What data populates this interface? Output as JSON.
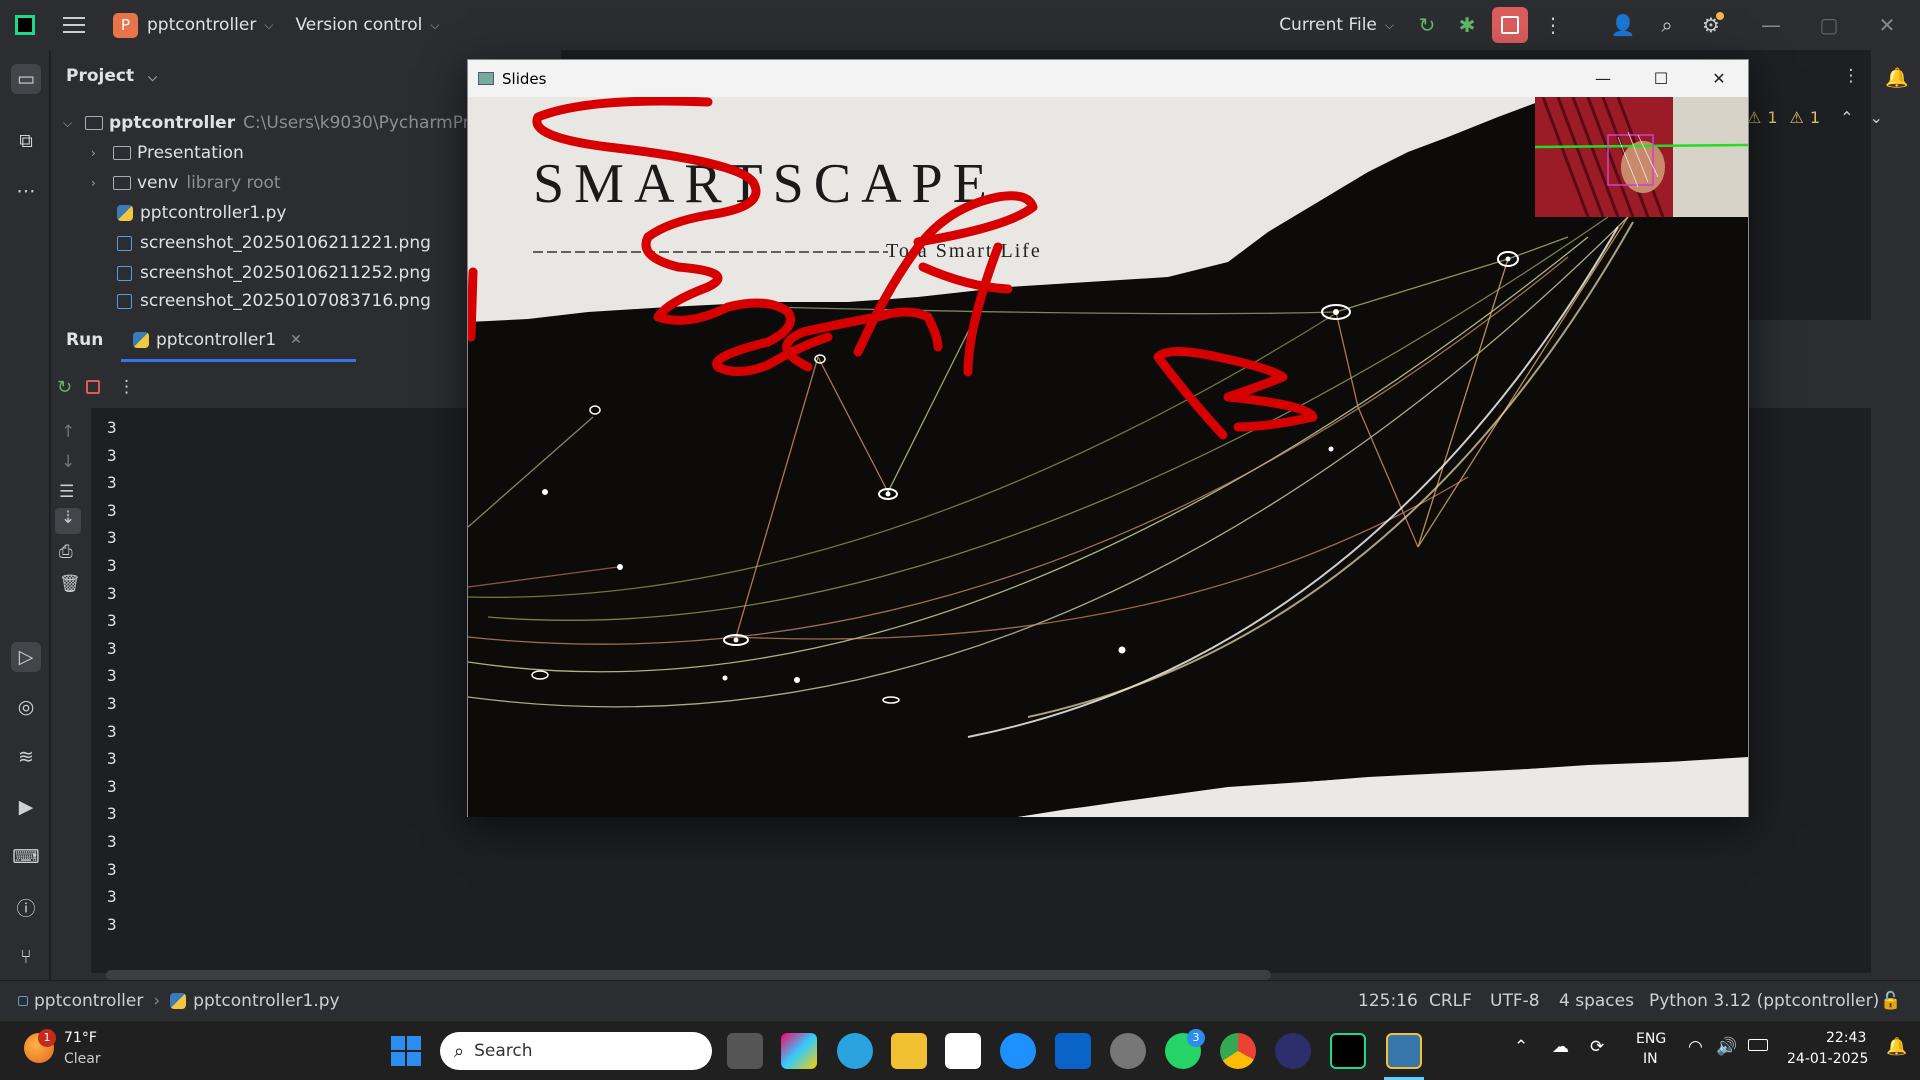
{
  "titlebar": {
    "project_badge": "P",
    "project_name": "pptcontroller",
    "version_control": "Version control",
    "run_config": "Current File"
  },
  "project_panel": {
    "title": "Project",
    "tree": [
      {
        "label": "pptcontroller",
        "path": "C:\\Users\\k9030\\PycharmProje",
        "type": "root"
      },
      {
        "label": "Presentation",
        "type": "folder"
      },
      {
        "label": "venv",
        "note": "library root",
        "type": "folder"
      },
      {
        "label": "pptcontroller1.py",
        "type": "py"
      },
      {
        "label": "screenshot_20250106211221.png",
        "type": "png"
      },
      {
        "label": "screenshot_20250106211252.png",
        "type": "png"
      },
      {
        "label": "screenshot_20250107083716.png",
        "type": "png"
      }
    ]
  },
  "editor": {
    "warning_a": "1",
    "warning_b": "1"
  },
  "run_panel": {
    "tab_run": "Run",
    "tab_file": "pptcontroller1",
    "output_lines": [
      "3",
      "3",
      "3",
      "3",
      "3",
      "3",
      "3",
      "3",
      "3",
      "3",
      "3",
      "3",
      "3",
      "3",
      "3",
      "3",
      "3",
      "3",
      "3"
    ]
  },
  "slides_window": {
    "title": "Slides",
    "slide_heading": "SMARTSCAPE",
    "slide_subtitle": "To a Smart Life",
    "colors": {
      "background": "#e9e7e3",
      "dark": "#0c0b0a",
      "ink": "#d70000"
    }
  },
  "statusbar": {
    "project": "pptcontroller",
    "file": "pptcontroller1.py",
    "position": "125:16",
    "line_ending": "CRLF",
    "encoding": "UTF-8",
    "indent": "4 spaces",
    "interpreter": "Python 3.12 (pptcontroller)"
  },
  "taskbar": {
    "weather_badge": "1",
    "temperature": "71°F",
    "condition": "Clear",
    "search_placeholder": "Search",
    "whatsapp_badge": "3",
    "lang_1": "ENG",
    "lang_2": "IN",
    "time": "22:43",
    "date": "24-01-2025"
  }
}
